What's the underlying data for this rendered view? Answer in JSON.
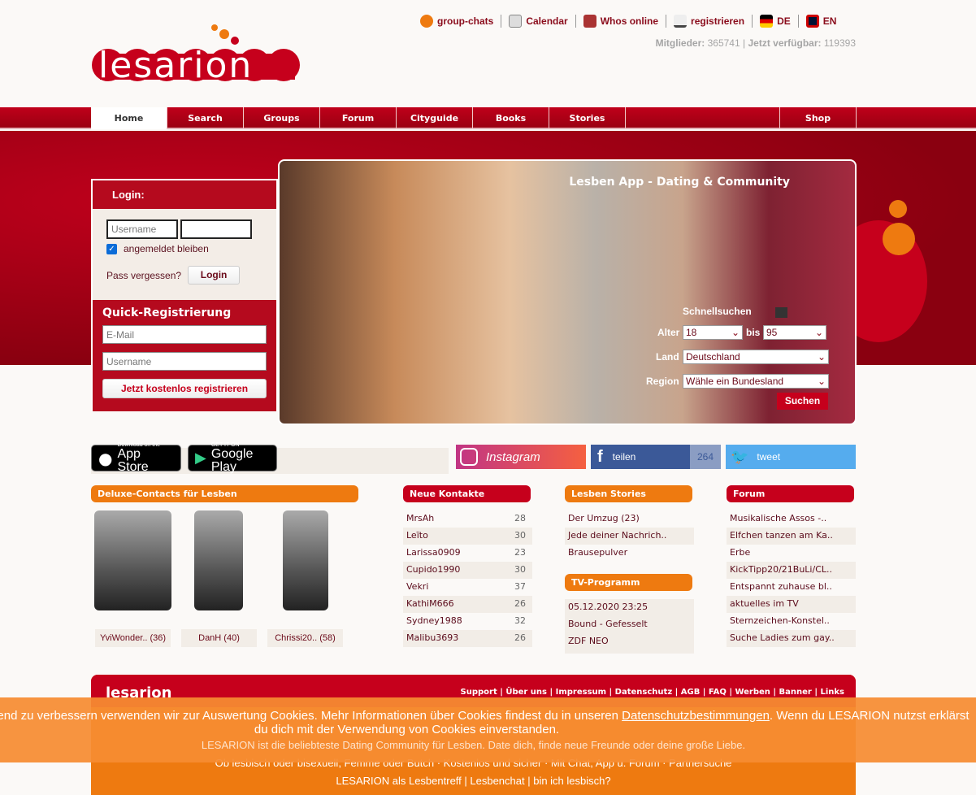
{
  "logo": "lesarion",
  "top_links": [
    {
      "label": "group-chats",
      "icon": "chat-icon"
    },
    {
      "label": "Calendar",
      "icon": "calendar-icon"
    },
    {
      "label": "Whos online",
      "icon": "people-icon"
    },
    {
      "label": "registrieren",
      "icon": "register-icon"
    },
    {
      "label": "DE",
      "icon": "flag-de-icon"
    },
    {
      "label": "EN",
      "icon": "flag-uk-icon"
    }
  ],
  "stats": {
    "members_label": "Mitglieder:",
    "members": "365741",
    "sep": "|",
    "available_label": "Jetzt verfügbar:",
    "available": "119393"
  },
  "nav": [
    "Home",
    "Search",
    "Groups",
    "Forum",
    "Cityguide",
    "Books",
    "Stories",
    "",
    "Shop"
  ],
  "login": {
    "title": "Login:",
    "username_placeholder": "Username",
    "remember": "angemeldet bleiben",
    "forgot": "Pass vergessen?",
    "button": "Login"
  },
  "quick_reg": {
    "title": "Quick-Registrierung",
    "email_placeholder": "E-Mail",
    "username_placeholder": "Username",
    "button": "Jetzt kostenlos registrieren"
  },
  "hero": {
    "title": "Lesben App - Dating & Community"
  },
  "quicksearch": {
    "title": "Schnellsuchen",
    "age_label": "Alter",
    "age_from": "18",
    "bis": "bis",
    "age_to": "95",
    "land_label": "Land",
    "land": "Deutschland",
    "region_label": "Region",
    "region": "Wähle ein Bundesland",
    "button": "Suchen"
  },
  "apps": {
    "apple_small": "Download on the",
    "apple_big": "App Store",
    "google_small": "GET IT ON",
    "google_big": "Google Play"
  },
  "social": {
    "instagram": "Instagram",
    "facebook": "teilen",
    "facebook_count": "264",
    "twitter": "tweet"
  },
  "deluxe": {
    "title": "Deluxe-Contacts für Lesben",
    "items": [
      "YviWonder.. (36)",
      "DanH (40)",
      "Chrissi20.. (58)"
    ]
  },
  "neue": {
    "title": "Neue Kontakte",
    "items": [
      [
        "MrsAh",
        "28"
      ],
      [
        "Leïto",
        "30"
      ],
      [
        "Larissa0909",
        "23"
      ],
      [
        "Cupido1990",
        "30"
      ],
      [
        "Vekri",
        "37"
      ],
      [
        "KathiM666",
        "26"
      ],
      [
        "Sydney1988",
        "32"
      ],
      [
        "Malibu3693",
        "26"
      ]
    ]
  },
  "stories": {
    "title": "Lesben Stories",
    "items": [
      "Der Umzug (23)",
      "Jede deiner Nachrich..",
      "Brausepulver"
    ]
  },
  "tv": {
    "title": "TV-Programm",
    "items": [
      "05.12.2020 23:25",
      "Bound - Gefesselt",
      "ZDF NEO"
    ]
  },
  "forum": {
    "title": "Forum",
    "items": [
      "Musikalische Assos -..",
      "Elfchen tanzen am Ka..",
      "Erbe",
      "KickTipp20/21BuLi/CL..",
      "Entspannt zuhause bl..",
      "aktuelles im TV",
      "Sternzeichen-Konstel..",
      "Suche Ladies zum gay.."
    ]
  },
  "footer": {
    "links": "Support | Über uns | Impressum | Datenschutz | AGB | FAQ | Werben | Banner | Links",
    "line1": "LESARION ist die beliebteste Dating Community für Lesben. Date dich, finde neue Freunde oder deine große Liebe.",
    "line2": "Ob lesbisch oder bisexuell, Femme oder Butch · Kostenlos und sicher · Mit Chat, App u. Forum · Partnersuche",
    "line3": "LESARION als Lesbentreff | Lesbenchat | bin ich lesbisch?"
  },
  "cookie": {
    "text1": "end zu verbessern verwenden wir zur Auswertung Cookies. Mehr Informationen über Cookies findest du in unseren ",
    "link": "Datenschutzbestimmungen",
    "text2": ". Wenn du LESARION nutzst erklärst",
    "line2": "du dich mit der Verwendung von Cookies einverstanden."
  },
  "colors": {
    "red": "#c6001c",
    "orange": "#ee7a10",
    "cream": "#f2ede7"
  }
}
